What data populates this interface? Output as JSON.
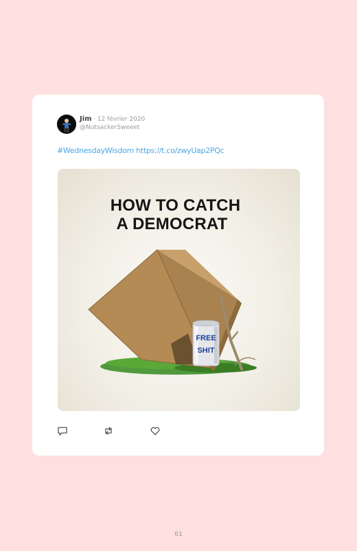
{
  "tweet": {
    "author_name": "Jim",
    "date": "· 12 février 2020",
    "handle": "@NutsackerSweeet",
    "text": "#WednesdayWisdom https://t.co/zwyUap2PQc",
    "image": {
      "headline_line1": "HOW TO CATCH",
      "headline_line2": "A DEMOCRAT",
      "can_label_line1": "FREE",
      "can_label_line2": "SHIT"
    },
    "actions": [
      {
        "icon": "reply-icon"
      },
      {
        "icon": "retweet-icon"
      },
      {
        "icon": "like-icon"
      }
    ]
  },
  "page_number": "61",
  "colors": {
    "page_background": "#fde0df",
    "link": "#4aa8e6",
    "card": "#ffffff"
  }
}
